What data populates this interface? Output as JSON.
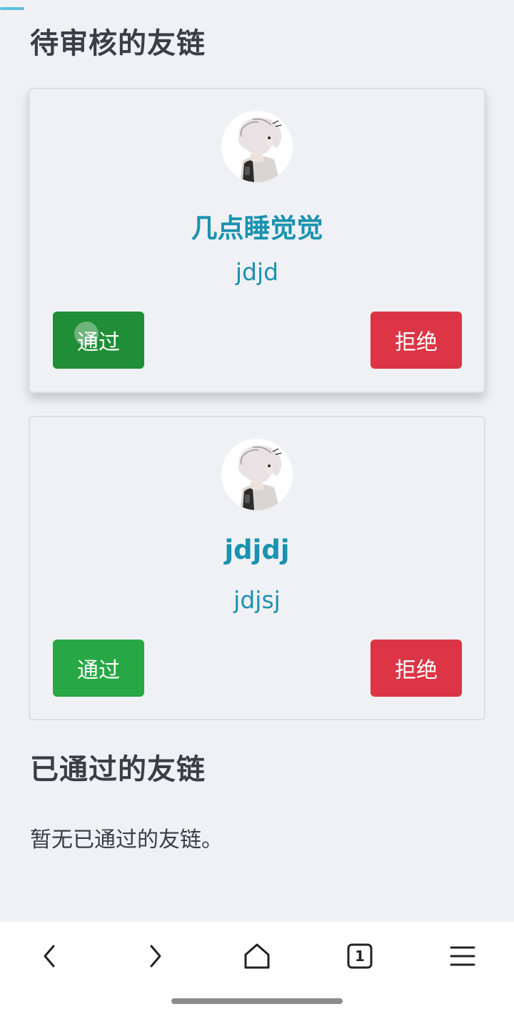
{
  "pending_section": {
    "title": "待审核的友链",
    "cards": [
      {
        "name": "几点睡觉觉",
        "desc": "jdjd",
        "approve_label": "通过",
        "reject_label": "拒绝"
      },
      {
        "name": "jdjdj",
        "desc": "jdjsj",
        "approve_label": "通过",
        "reject_label": "拒绝"
      }
    ]
  },
  "approved_section": {
    "title": "已通过的友链",
    "empty_text": "暂无已通过的友链。"
  },
  "browser_bar": {
    "icons": [
      "back-icon",
      "forward-icon",
      "home-icon",
      "tabs-icon",
      "menu-icon"
    ],
    "tab_count": "1"
  },
  "colors": {
    "accent": "#1b92b0",
    "approve": "#28a745",
    "reject": "#dc3545",
    "background": "#f0f1f5"
  }
}
